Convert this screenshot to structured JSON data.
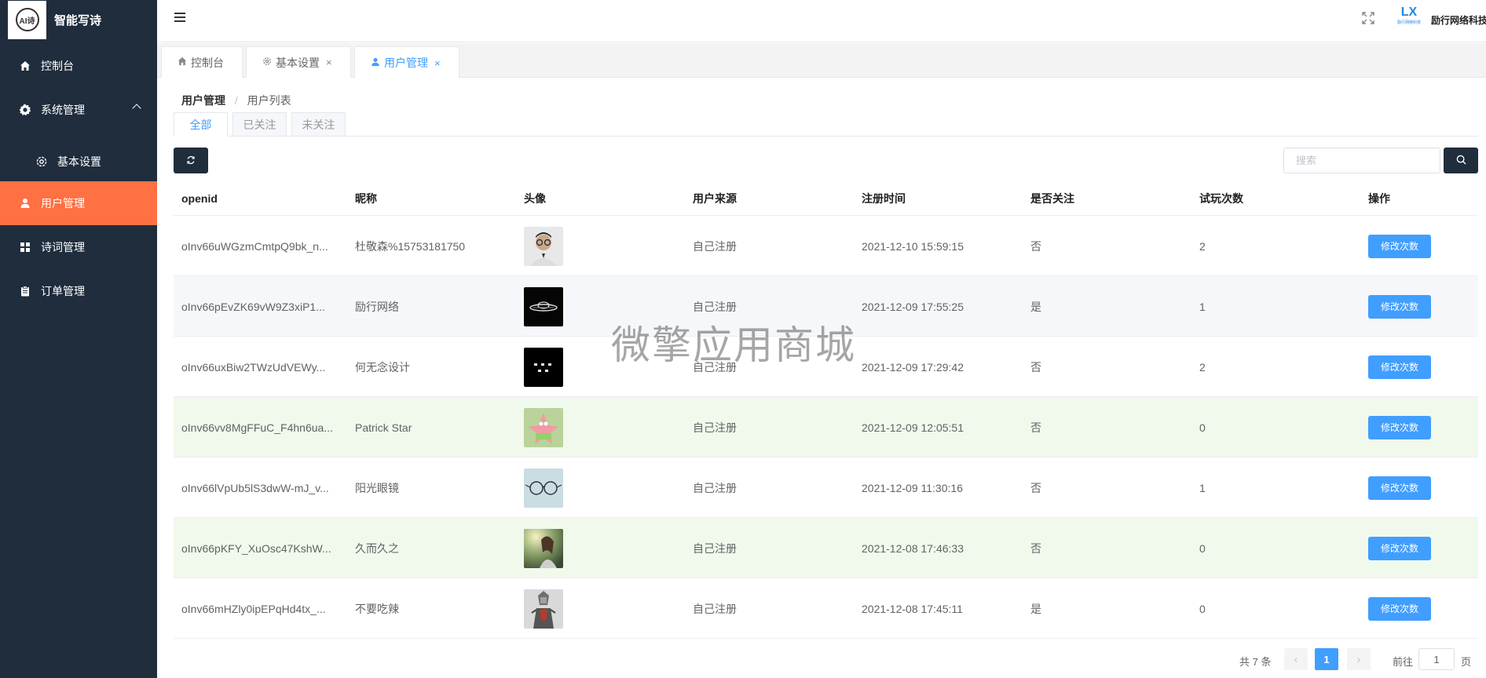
{
  "app": {
    "title": "智能写诗",
    "logo_text": "AI诗"
  },
  "sidebar": {
    "items": [
      {
        "label": "控制台",
        "icon": "home-icon"
      },
      {
        "label": "系统管理",
        "icon": "gear-icon",
        "expanded": true
      },
      {
        "label": "基本设置",
        "icon": "settings-outline-icon",
        "sub": true
      },
      {
        "label": "用户管理",
        "icon": "user-icon",
        "active": true
      },
      {
        "label": "诗词管理",
        "icon": "grid-icon"
      },
      {
        "label": "订单管理",
        "icon": "clipboard-icon"
      }
    ]
  },
  "header": {
    "company_name": "励行网络科技",
    "company_logo_mark": "LX",
    "company_logo_small": "励行网络科技"
  },
  "tabs": [
    {
      "label": "控制台",
      "icon": "home-icon",
      "closable": false
    },
    {
      "label": "基本设置",
      "icon": "settings-outline-icon",
      "closable": true
    },
    {
      "label": "用户管理",
      "icon": "user-icon",
      "closable": true,
      "active": true
    }
  ],
  "breadcrumb": {
    "parent": "用户管理",
    "current": "用户列表",
    "separator": "/"
  },
  "filter_tabs": [
    {
      "label": "全部",
      "active": true
    },
    {
      "label": "已关注"
    },
    {
      "label": "未关注"
    }
  ],
  "search": {
    "placeholder": "搜索"
  },
  "table": {
    "columns": [
      "openid",
      "昵称",
      "头像",
      "用户来源",
      "注册时间",
      "是否关注",
      "试玩次数",
      "操作"
    ],
    "action_label": "修改次数",
    "rows": [
      {
        "openid": "oInv66uWGzmCmtpQ9bk_n...",
        "nickname": "杜敬森%15753181750",
        "avatar": "man-glasses-avatar",
        "source": "自己注册",
        "registered": "2021-12-10 15:59:15",
        "following": "否",
        "trials": "2"
      },
      {
        "openid": "oInv66pEvZK69vW9Z3xiP1...",
        "nickname": "励行网络",
        "avatar": "ufo-avatar",
        "source": "自己注册",
        "registered": "2021-12-09 17:55:25",
        "following": "是",
        "trials": "1"
      },
      {
        "openid": "oInv66uxBiw2TWzUdVEWy...",
        "nickname": "何无念设计",
        "avatar": "design-text-avatar",
        "source": "自己注册",
        "registered": "2021-12-09 17:29:42",
        "following": "否",
        "trials": "2"
      },
      {
        "openid": "oInv66vv8MgFFuC_F4hn6ua...",
        "nickname": "Patrick Star",
        "avatar": "patrick-star-avatar",
        "source": "自己注册",
        "registered": "2021-12-09 12:05:51",
        "following": "否",
        "trials": "0"
      },
      {
        "openid": "oInv66lVpUb5lS3dwW-mJ_v...",
        "nickname": "阳光眼镜",
        "avatar": "glasses-avatar",
        "source": "自己注册",
        "registered": "2021-12-09 11:30:16",
        "following": "否",
        "trials": "1"
      },
      {
        "openid": "oInv66pKFY_XuOsc47KshW...",
        "nickname": "久而久之",
        "avatar": "girl-sunlight-avatar",
        "source": "自己注册",
        "registered": "2021-12-08 17:46:33",
        "following": "否",
        "trials": "0"
      },
      {
        "openid": "oInv66mHZly0ipEPqHd4tx_...",
        "nickname": "不要吃辣",
        "avatar": "warrior-avatar",
        "source": "自己注册",
        "registered": "2021-12-08 17:45:11",
        "following": "是",
        "trials": "0"
      }
    ]
  },
  "watermark": "微擎应用商城",
  "pagination": {
    "total_text": "共 7 条",
    "current_page": "1",
    "goto_prefix": "前往",
    "goto_value": "1",
    "goto_suffix": "页"
  }
}
